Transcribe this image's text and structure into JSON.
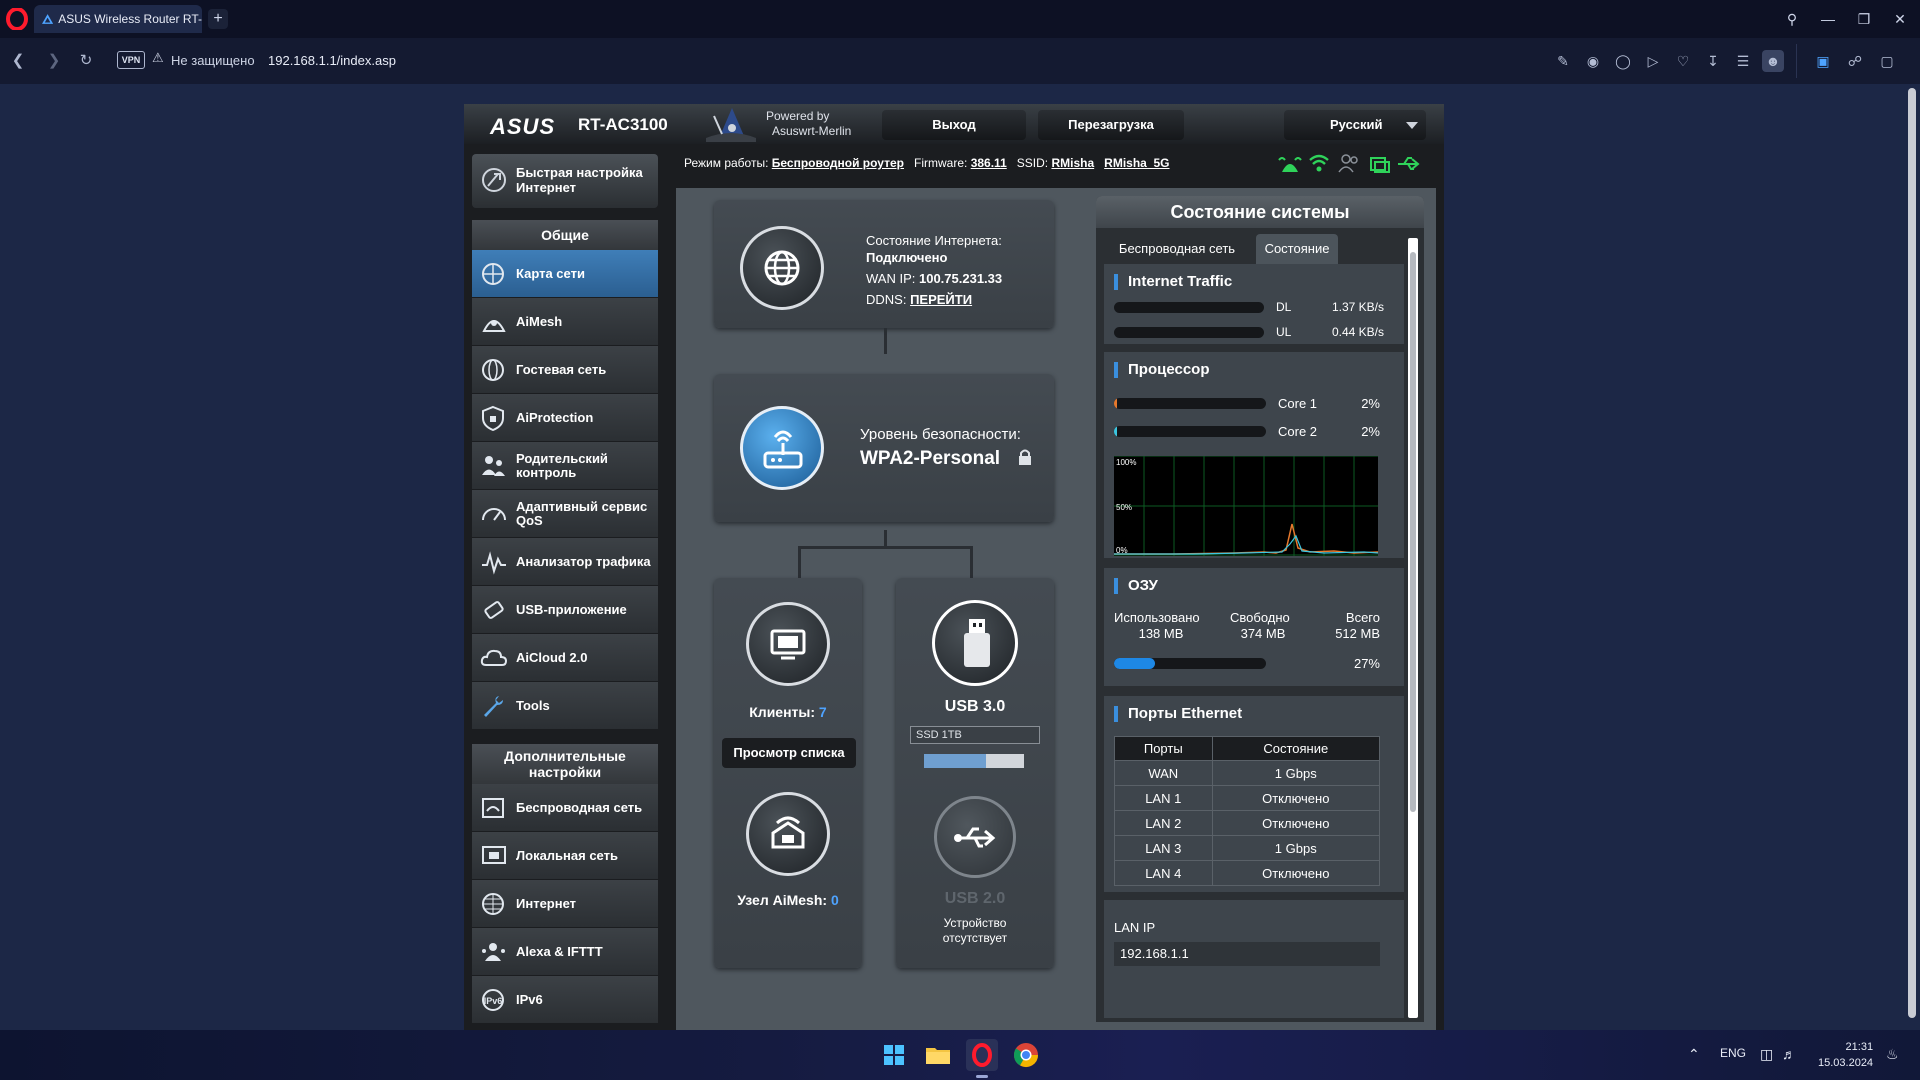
{
  "browser": {
    "tab_title": "ASUS Wireless Router RT-",
    "vpn": "VPN",
    "security_text": "Не защищено",
    "url": "192.168.1.1/index.asp"
  },
  "router": {
    "brand": "ASUS",
    "model": "RT-AC3100",
    "powered_by": "Powered by",
    "powered_name": "Asuswrt-Merlin",
    "buttons": {
      "logout": "Выход",
      "reboot": "Перезагрузка"
    },
    "language": "Русский",
    "status": {
      "mode_label": "Режим работы:",
      "mode_value": "Беспроводной роутер",
      "firmware_label": "Firmware:",
      "firmware_value": "386.11",
      "ssid_label": "SSID:",
      "ssid_1": "RMisha",
      "ssid_2": "RMisha_5G"
    }
  },
  "sidebar": {
    "quick_setup": "Быстрая настройка Интернет",
    "general_header": "Общие",
    "general_items": [
      {
        "label": "Карта сети",
        "icon": "network-map-icon",
        "active": true
      },
      {
        "label": "AiMesh",
        "icon": "aimesh-icon"
      },
      {
        "label": "Гостевая сеть",
        "icon": "guest-network-icon"
      },
      {
        "label": "AiProtection",
        "icon": "shield-icon"
      },
      {
        "label": "Родительский контроль",
        "icon": "parental-control-icon"
      },
      {
        "label": "Адаптивный сервис QoS",
        "icon": "qos-icon"
      },
      {
        "label": "Анализатор трафика",
        "icon": "traffic-analyzer-icon"
      },
      {
        "label": "USB-приложение",
        "icon": "usb-app-icon"
      },
      {
        "label": "AiCloud 2.0",
        "icon": "cloud-icon"
      },
      {
        "label": "Tools",
        "icon": "wrench-icon"
      }
    ],
    "advanced_header": "Дополнительные настройки",
    "advanced_items": [
      {
        "label": "Беспроводная сеть",
        "icon": "wireless-icon"
      },
      {
        "label": "Локальная сеть",
        "icon": "lan-icon"
      },
      {
        "label": "Интернет",
        "icon": "globe-icon"
      },
      {
        "label": "Alexa & IFTTT",
        "icon": "alexa-icon"
      },
      {
        "label": "IPv6",
        "icon": "ipv6-icon"
      }
    ]
  },
  "map": {
    "internet": {
      "status_label": "Состояние Интернета:",
      "status_value": "Подключено",
      "wan_label": "WAN IP:",
      "wan_value": "100.75.231.33",
      "ddns_label": "DDNS:",
      "ddns_value": "ПЕРЕЙТИ"
    },
    "security": {
      "label": "Уровень безопасности:",
      "value": "WPA2-Personal"
    },
    "clients": {
      "label": "Клиенты:",
      "count": "7",
      "button": "Просмотр списка"
    },
    "aimesh": {
      "label": "Узел AiMesh:",
      "count": "0"
    },
    "usb3": {
      "label": "USB 3.0",
      "device": "SSD 1TB",
      "usage_fraction": 0.62
    },
    "usb2": {
      "label": "USB 2.0",
      "status": "Устройство отсутствует"
    }
  },
  "system_status": {
    "title": "Состояние системы",
    "tabs": [
      "Беспроводная сеть",
      "Состояние"
    ],
    "traffic": {
      "title": "Internet Traffic",
      "dl_label": "DL",
      "dl_value": "1.37 KB/s",
      "ul_label": "UL",
      "ul_value": "0.44 KB/s"
    },
    "cpu": {
      "title": "Процессор",
      "cores": [
        {
          "name": "Core 1",
          "percent": "2%",
          "fraction": 0.02
        },
        {
          "name": "Core 2",
          "percent": "2%",
          "fraction": 0.02
        }
      ],
      "graph_labels": [
        "100%",
        "50%",
        "0%"
      ]
    },
    "ram": {
      "title": "ОЗУ",
      "used_label": "Использовано",
      "used_value": "138 MB",
      "free_label": "Свободно",
      "free_value": "374 MB",
      "total_label": "Всего",
      "total_value": "512 MB",
      "percent": "27%",
      "fraction": 0.27
    },
    "ports": {
      "title": "Порты Ethernet",
      "headers": [
        "Порты",
        "Состояние"
      ],
      "rows": [
        [
          "WAN",
          "1 Gbps"
        ],
        [
          "LAN 1",
          "Отключено"
        ],
        [
          "LAN 2",
          "Отключено"
        ],
        [
          "LAN 3",
          "1 Gbps"
        ],
        [
          "LAN 4",
          "Отключено"
        ]
      ]
    },
    "lan_ip": {
      "label": "LAN IP",
      "value": "192.168.1.1"
    }
  },
  "taskbar": {
    "lang": "ENG",
    "time": "21:31",
    "date": "15.03.2024"
  },
  "colors": {
    "accent_blue": "#3a8fde",
    "active_nav": "#3f7eb8",
    "status_green": "#2fd35a"
  }
}
